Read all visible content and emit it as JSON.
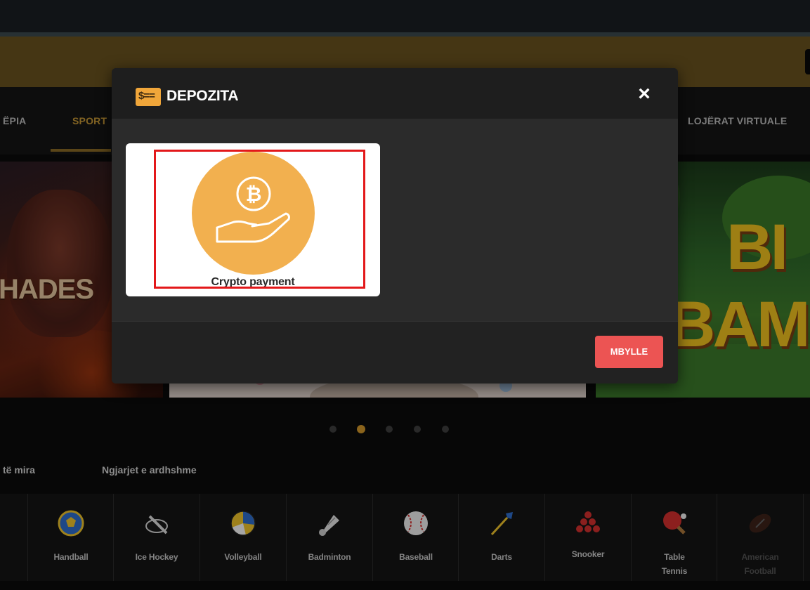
{
  "nav": {
    "items": [
      "ËPIA",
      "SPORT",
      "LOJËRAT VIRTUALE"
    ]
  },
  "banners": {
    "left_text": "HADES",
    "right_text_1": "BI",
    "right_text_2": "BAM"
  },
  "carousel": {
    "dot_count": 5,
    "active_index": 1
  },
  "tabs": [
    "të mira",
    "Ngjarjet e ardhshme"
  ],
  "sports": [
    {
      "label": "Handball",
      "icon": "handball-icon"
    },
    {
      "label": "Ice Hockey",
      "icon": "ice-hockey-icon"
    },
    {
      "label": "Volleyball",
      "icon": "volleyball-icon"
    },
    {
      "label": "Badminton",
      "icon": "badminton-icon"
    },
    {
      "label": "Baseball",
      "icon": "baseball-icon"
    },
    {
      "label": "Darts",
      "icon": "darts-icon"
    },
    {
      "label": "Snooker",
      "icon": "snooker-icon"
    },
    {
      "label_line1": "Table",
      "label_line2": "Tennis",
      "icon": "table-tennis-icon"
    },
    {
      "label_line1": "American",
      "label_line2": "Football",
      "icon": "american-football-icon"
    }
  ],
  "modal": {
    "icon_text": "$==",
    "title": "DEPOZITA",
    "close_icon": "×",
    "payment_option": {
      "label": "Crypto payment",
      "icon": "bitcoin-hand-icon"
    },
    "close_button": "MBYLLE"
  },
  "colors": {
    "accent": "#f0a63a",
    "close_button": "#ec5453",
    "highlight": "#e3181a",
    "coin_circle": "#f2b04f"
  }
}
